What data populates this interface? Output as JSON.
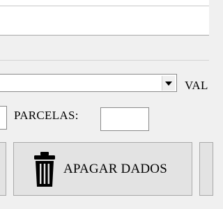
{
  "form": {
    "combo_value": "",
    "valor_label": "VAL",
    "left_input_value": "",
    "parcelas_label": "PARCELAS:",
    "parcelas_value": ""
  },
  "buttons": {
    "delete_label": "APAGAR DADOS"
  },
  "icons": {
    "combo_arrow": "chevron-down-icon",
    "delete": "trash-icon"
  }
}
